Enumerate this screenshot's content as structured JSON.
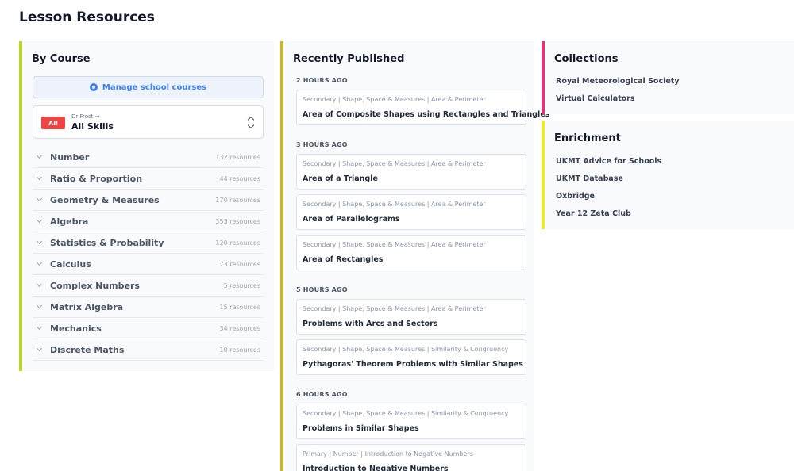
{
  "page": {
    "title": "Lesson Resources"
  },
  "by_course": {
    "title": "By Course",
    "manage_button": "Manage school courses",
    "filter": {
      "badge": "All",
      "owner": "Dr Frost →",
      "value": "All Skills"
    },
    "courses": [
      {
        "name": "Number",
        "count": "132 resources"
      },
      {
        "name": "Ratio & Proportion",
        "count": "44 resources"
      },
      {
        "name": "Geometry & Measures",
        "count": "170 resources"
      },
      {
        "name": "Algebra",
        "count": "353 resources"
      },
      {
        "name": "Statistics & Probability",
        "count": "120 resources"
      },
      {
        "name": "Calculus",
        "count": "73 resources"
      },
      {
        "name": "Complex Numbers",
        "count": "5 resources"
      },
      {
        "name": "Matrix Algebra",
        "count": "15 resources"
      },
      {
        "name": "Mechanics",
        "count": "34 resources"
      },
      {
        "name": "Discrete Maths",
        "count": "10 resources"
      }
    ]
  },
  "recent": {
    "title": "Recently Published",
    "groups": [
      {
        "label": "2 HOURS AGO",
        "items": [
          {
            "tags": "Secondary | Shape, Space & Measures | Area & Perimeter",
            "title": "Area of Composite Shapes using Rectangles and Triangles"
          }
        ]
      },
      {
        "label": "3 HOURS AGO",
        "items": [
          {
            "tags": "Secondary | Shape, Space & Measures | Area & Perimeter",
            "title": "Area of a Triangle"
          },
          {
            "tags": "Secondary | Shape, Space & Measures | Area & Perimeter",
            "title": "Area of Parallelograms"
          },
          {
            "tags": "Secondary | Shape, Space & Measures | Area & Perimeter",
            "title": "Area of Rectangles"
          }
        ]
      },
      {
        "label": "5 HOURS AGO",
        "items": [
          {
            "tags": "Secondary | Shape, Space & Measures | Area & Perimeter",
            "title": "Problems with Arcs and Sectors"
          },
          {
            "tags": "Secondary | Shape, Space & Measures | Similarity & Congruency",
            "title": "Pythagoras' Theorem Problems with Similar Shapes"
          }
        ]
      },
      {
        "label": "6 HOURS AGO",
        "items": [
          {
            "tags": "Secondary | Shape, Space & Measures | Similarity & Congruency",
            "title": "Problems in Similar Shapes"
          },
          {
            "tags": "Primary | Number | Introduction to Negative Numbers",
            "title": "Introduction to Negative Numbers"
          }
        ]
      }
    ]
  },
  "collections": {
    "title": "Collections",
    "items": [
      "Royal Meteorological Society",
      "Virtual Calculators"
    ]
  },
  "enrichment": {
    "title": "Enrichment",
    "items": [
      "UKMT Advice for Schools",
      "UKMT Database",
      "Oxbridge",
      "Year 12 Zeta Club"
    ]
  },
  "colors": {
    "course_accent": "#b8d62a",
    "recent_accent": "#c9b52b",
    "collections_accent": "#e0327e",
    "enrichment_accent": "#f1e92a",
    "badge_red": "#ef4444",
    "link_blue": "#3b82f6"
  }
}
